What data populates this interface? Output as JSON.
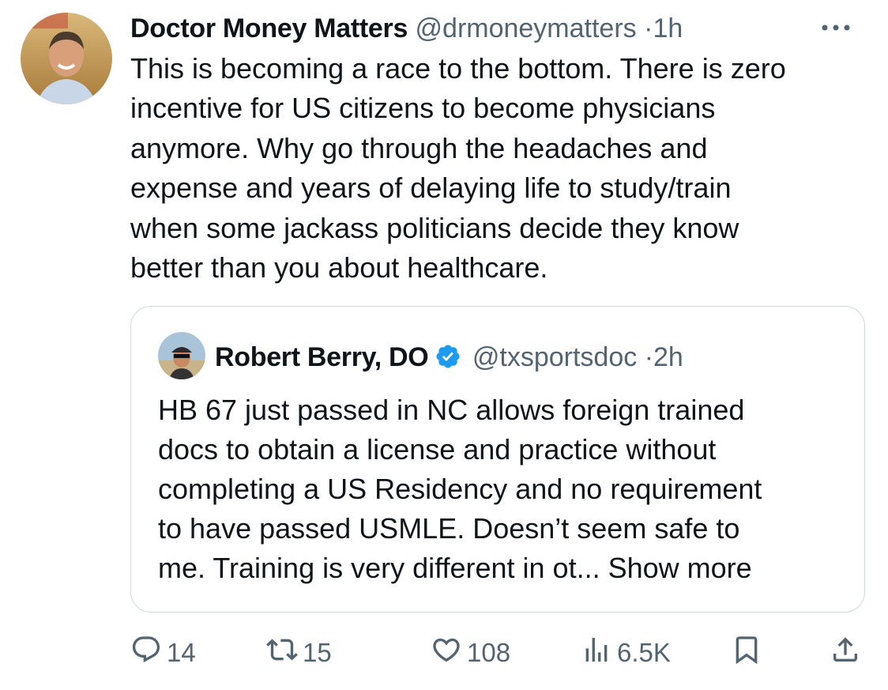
{
  "tweet": {
    "author_name": "Doctor Money Matters",
    "handle": "@drmoneymatters",
    "separator": "·",
    "time": "1h",
    "text": "This is becoming a race to the bottom. There is zero\nincentive for US citizens to become physicians\nanymore. Why go through the headaches and\nexpense and years of delaying life to study/train\nwhen some jackass politicians decide they know\nbetter than you about healthcare."
  },
  "quoted_tweet": {
    "author_name": "Robert Berry, DO",
    "handle": "@txsportsdoc",
    "separator": "·",
    "time": "2h",
    "text": "HB 67 just passed in NC allows foreign trained\ndocs to obtain a license and practice without\ncompleting a US Residency and no requirement\nto have passed USMLE. Doesn’t seem safe to\nme. Training is very different in ot...",
    "show_more": "Show more"
  },
  "actions": {
    "replies": "14",
    "retweets": "15",
    "likes": "108",
    "views": "6.5K"
  },
  "colors": {
    "text": "#0f1419",
    "secondary": "#536471",
    "border": "#cfd9de",
    "verified": "#1d9bf0"
  },
  "icons": [
    "more-icon",
    "verified-badge-icon",
    "reply-icon",
    "retweet-icon",
    "like-icon",
    "views-icon",
    "bookmark-icon",
    "share-icon"
  ]
}
